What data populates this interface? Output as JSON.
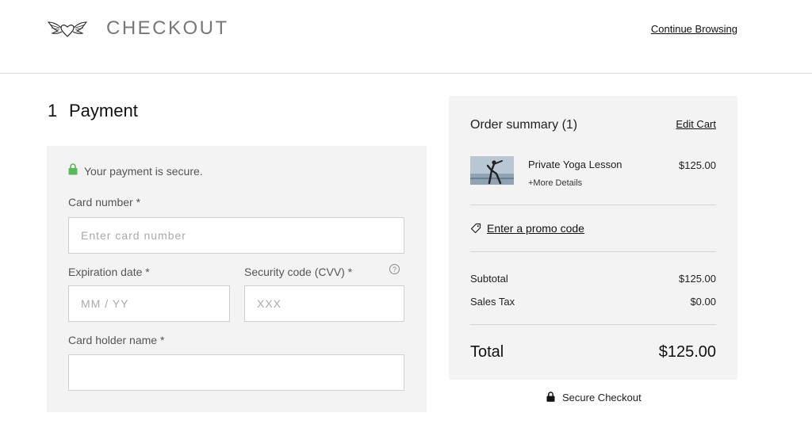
{
  "header": {
    "title": "CHECKOUT",
    "logo_icon": "winged-heart-icon",
    "continue_label": "Continue Browsing"
  },
  "payment": {
    "step_number": "1",
    "step_title": "Payment",
    "secure_text": "Your payment is secure.",
    "secure_icon": "lock-icon",
    "secure_color": "#5cb85c",
    "card_number_label": "Card number *",
    "card_number_placeholder": "Enter card number",
    "expiration_label": "Expiration date *",
    "expiration_placeholder": "MM / YY",
    "cvv_label": "Security code (CVV) *",
    "cvv_placeholder": "XXX",
    "help_icon": "question-circle-icon",
    "holder_label": "Card holder name *",
    "holder_value": ""
  },
  "summary": {
    "title": "Order summary (1)",
    "edit_label": "Edit Cart",
    "item": {
      "name": "Private Yoga Lesson",
      "more": "+More Details",
      "price": "$125.00"
    },
    "promo_icon": "tag-icon",
    "promo_label": "Enter a promo code",
    "subtotal_label": "Subtotal",
    "subtotal_value": "$125.00",
    "tax_label": "Sales Tax",
    "tax_value": "$0.00",
    "total_label": "Total",
    "total_value": "$125.00"
  },
  "footer": {
    "secure_checkout": "Secure Checkout",
    "lock_icon": "lock-icon"
  }
}
